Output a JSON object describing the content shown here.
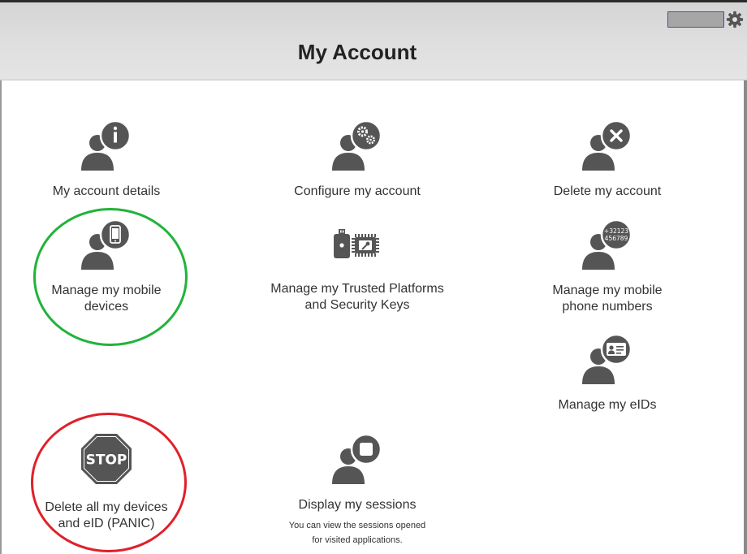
{
  "header": {
    "title": "My Account"
  },
  "tiles": [
    {
      "label": "My account details",
      "icon": "user-info-icon"
    },
    {
      "label": "Configure my account",
      "icon": "user-gears-icon"
    },
    {
      "label": "Delete my account",
      "icon": "user-delete-icon"
    },
    {
      "label": "Manage my mobile devices",
      "icon": "user-mobile-icon"
    },
    {
      "label": "Manage my Trusted Platforms and Security Keys",
      "icon": "security-key-chip-icon"
    },
    {
      "label": "Manage my mobile phone numbers",
      "icon": "user-phone-number-icon",
      "badge_line1": "+32123",
      "badge_line2": "456789"
    },
    {
      "label": "Manage my eIDs",
      "icon": "user-id-card-icon"
    },
    {
      "label": "Delete all my devices and eID (PANIC)",
      "icon": "stop-sign-icon",
      "sign_text": "STOP"
    },
    {
      "label": "Display my sessions",
      "icon": "user-sessions-icon",
      "description_line1": "You can view the sessions opened",
      "description_line2": "for visited applications."
    }
  ],
  "colors": {
    "icon": "#555555",
    "highlight_green": "#22b33a",
    "highlight_red": "#e0202a",
    "user_chip_border": "#7b2fbf"
  }
}
